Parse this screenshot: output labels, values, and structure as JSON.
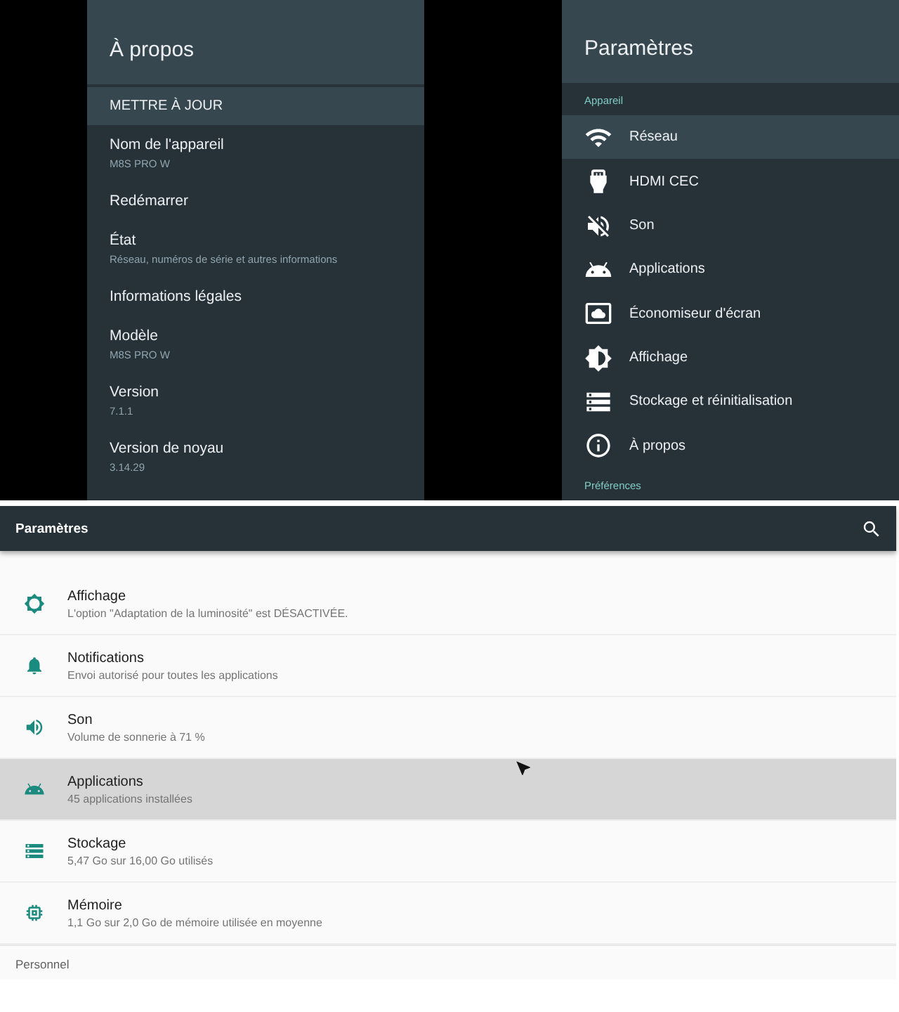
{
  "about_panel": {
    "title": "À propos",
    "items": [
      {
        "title": "METTRE À JOUR",
        "selected": true
      },
      {
        "title": "Nom de l'appareil",
        "subtitle": "M8S PRO W",
        "selected": false
      },
      {
        "title": "Redémarrer",
        "selected": false
      },
      {
        "title": "État",
        "subtitle": "Réseau, numéros de série et autres informations",
        "selected": false
      },
      {
        "title": "Informations légales",
        "selected": false
      },
      {
        "title": "Modèle",
        "subtitle": "M8S PRO W",
        "selected": false
      },
      {
        "title": "Version",
        "subtitle": "7.1.1",
        "selected": false
      },
      {
        "title": "Version de noyau",
        "subtitle": "3.14.29",
        "selected": false
      }
    ]
  },
  "settings_panel": {
    "title": "Paramètres",
    "section": "Appareil",
    "items": [
      {
        "label": "Réseau",
        "selected": true
      },
      {
        "label": "HDMI CEC",
        "selected": false
      },
      {
        "label": "Son",
        "selected": false
      },
      {
        "label": "Applications",
        "selected": false
      },
      {
        "label": "Économiseur d'écran",
        "selected": false
      },
      {
        "label": "Affichage",
        "selected": false
      },
      {
        "label": "Stockage et réinitialisation",
        "selected": false
      },
      {
        "label": "À propos",
        "selected": false
      }
    ],
    "next_section": "Préférences"
  },
  "phone_settings": {
    "title": "Paramètres",
    "items": [
      {
        "title": "Affichage",
        "subtitle": "L'option \"Adaptation de la luminosité\" est DÉSACTIVÉE.",
        "selected": false
      },
      {
        "title": "Notifications",
        "subtitle": "Envoi autorisé pour toutes les applications",
        "selected": false
      },
      {
        "title": "Son",
        "subtitle": "Volume de sonnerie à 71 %",
        "selected": false
      },
      {
        "title": "Applications",
        "subtitle": "45 applications installées",
        "selected": true
      },
      {
        "title": "Stockage",
        "subtitle": "5,47 Go sur 16,00 Go utilisés",
        "selected": false
      },
      {
        "title": "Mémoire",
        "subtitle": "1,1 Go sur 2,0 Go de mémoire utilisée en moyenne",
        "selected": false
      }
    ],
    "next_section": "Personnel"
  }
}
